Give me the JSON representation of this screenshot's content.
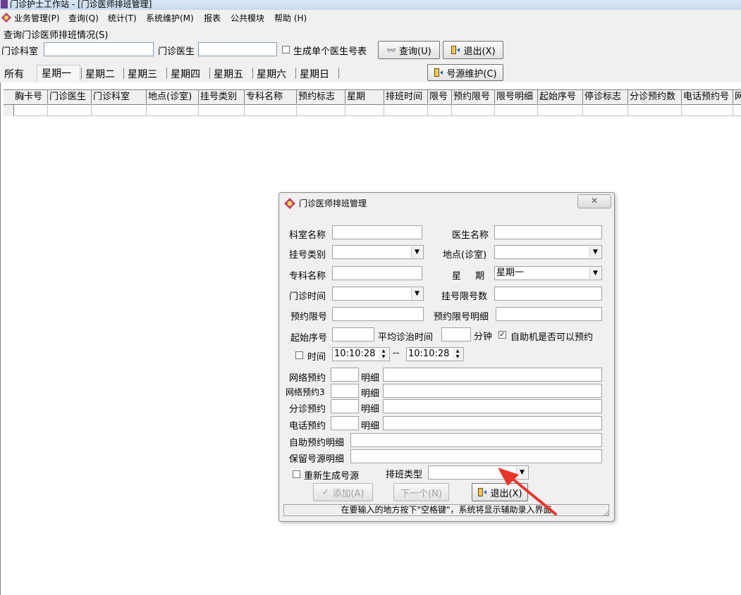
{
  "window": {
    "title": "门诊护士工作站 - [门诊医师排班管理]"
  },
  "menu": [
    "业务管理(P)",
    "查询(Q)",
    "统计(T)",
    "系统维护(M)",
    "报表",
    "公共模块",
    "帮助 (H)"
  ],
  "query": {
    "group_label": "查询门诊医师排班情况(S)",
    "dept_label": "门诊科室",
    "dept_value": "",
    "doctor_label": "门诊医生",
    "doctor_value": "",
    "single_doctor_label": "生成单个医生号表",
    "search_button": "查询(U)",
    "exit_button": "退出(X)"
  },
  "tabs": [
    "所有",
    "星期一",
    "星期二",
    "星期三",
    "星期四",
    "星期五",
    "星期六",
    "星期日"
  ],
  "source_maintain_button": "号源维护(C)",
  "grid": {
    "columns": [
      "胸卡号",
      "门诊医生",
      "门诊科室",
      "地点(诊室)",
      "挂号类别",
      "专科名称",
      "预约标志",
      "星期",
      "排班时间",
      "限号",
      "预约限号",
      "限号明细",
      "起始序号",
      "停诊标志",
      "分诊预约数",
      "电话预约号",
      "网"
    ]
  },
  "dialog": {
    "title": "门诊医师排班管理",
    "close": "✕",
    "dept_name_label": "科室名称",
    "dept_name_value": "",
    "doctor_name_label": "医生名称",
    "doctor_name_value": "",
    "reg_type_label": "挂号类别",
    "reg_type_value": "",
    "location_label": "地点(诊室)",
    "location_value": "",
    "specialty_label": "专科名称",
    "specialty_value": "",
    "weekday_label": "星　 期",
    "weekday_value": "星期一",
    "clinic_time_label": "门诊时间",
    "clinic_time_value": "",
    "reg_limit_label": "挂号限号数",
    "reg_limit_value": "",
    "appt_limit_label": "预约限号",
    "appt_limit_value": "",
    "appt_limit_detail_label": "预约限号明细",
    "appt_limit_detail_value": "",
    "start_no_label": "起始序号",
    "start_no_value": "",
    "avg_time_label": "平均诊治时间",
    "avg_time_value": "",
    "minutes_label": "分钟",
    "kiosk_label": "自助机是否可以预约",
    "kiosk_checked": "✓",
    "time_label": "时间",
    "time_from": "10:10:28",
    "time_sep": "--",
    "time_to": "10:10:28",
    "net_appt_label": "网络预约",
    "net_appt3_label": "网络预约3",
    "triage_appt_label": "分诊预约",
    "phone_appt_label": "电话预约",
    "detail_label": "明细",
    "self_appt_detail_label": "自助预约明细",
    "reserved_detail_label": "保留号源明细",
    "regen_label": "重新生成号源",
    "schedule_type_label": "排班类型",
    "schedule_type_value": "",
    "add_button": "添加(A)",
    "next_button": "下一个(N)",
    "exit_button": "退出(X)",
    "status_text": "在要输入的地方按下\"空格键\"，系统将显示辅助录入界面"
  },
  "colors": {
    "annotation_arrow": "#e8352b",
    "window_bg": "#f0f0f0"
  }
}
